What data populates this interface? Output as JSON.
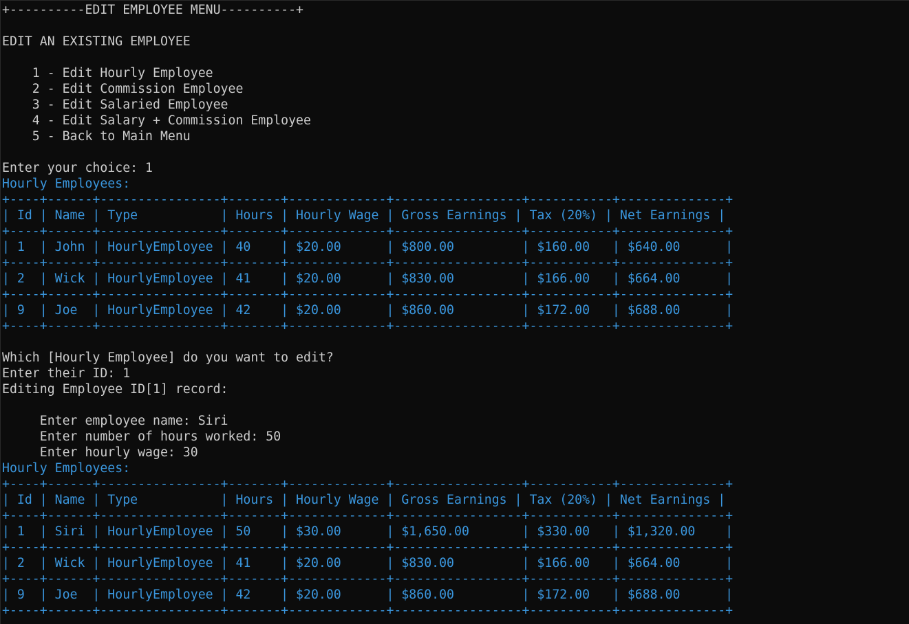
{
  "lines": [
    {
      "text": "+----------EDIT EMPLOYEE MENU----------+",
      "color": "white"
    },
    {
      "text": "",
      "color": "white"
    },
    {
      "text": "EDIT AN EXISTING EMPLOYEE",
      "color": "white"
    },
    {
      "text": "",
      "color": "white"
    },
    {
      "text": "    1 - Edit Hourly Employee",
      "color": "white"
    },
    {
      "text": "    2 - Edit Commission Employee",
      "color": "white"
    },
    {
      "text": "    3 - Edit Salaried Employee",
      "color": "white"
    },
    {
      "text": "    4 - Edit Salary + Commission Employee",
      "color": "white"
    },
    {
      "text": "    5 - Back to Main Menu",
      "color": "white"
    },
    {
      "text": "",
      "color": "white"
    },
    {
      "text": "Enter your choice: 1",
      "color": "white"
    },
    {
      "text": "Hourly Employees:",
      "color": "blue"
    },
    {
      "text": "+----+------+----------------+-------+-------------+-----------------+-----------+--------------+",
      "color": "blue"
    },
    {
      "text": "| Id | Name | Type           | Hours | Hourly Wage | Gross Earnings | Tax (20%) | Net Earnings |",
      "color": "blue"
    },
    {
      "text": "+----+------+----------------+-------+-------------+-----------------+-----------+--------------+",
      "color": "blue"
    },
    {
      "text": "| 1  | John | HourlyEmployee | 40    | $20.00      | $800.00         | $160.00   | $640.00      |",
      "color": "blue"
    },
    {
      "text": "+----+------+----------------+-------+-------------+-----------------+-----------+--------------+",
      "color": "blue"
    },
    {
      "text": "| 2  | Wick | HourlyEmployee | 41    | $20.00      | $830.00         | $166.00   | $664.00      |",
      "color": "blue"
    },
    {
      "text": "+----+------+----------------+-------+-------------+-----------------+-----------+--------------+",
      "color": "blue"
    },
    {
      "text": "| 9  | Joe  | HourlyEmployee | 42    | $20.00      | $860.00         | $172.00   | $688.00      |",
      "color": "blue"
    },
    {
      "text": "+----+------+----------------+-------+-------------+-----------------+-----------+--------------+",
      "color": "blue"
    },
    {
      "text": "",
      "color": "white"
    },
    {
      "text": "Which [Hourly Employee] do you want to edit?",
      "color": "white"
    },
    {
      "text": "Enter their ID: 1",
      "color": "white"
    },
    {
      "text": "Editing Employee ID[1] record:",
      "color": "white"
    },
    {
      "text": "",
      "color": "white"
    },
    {
      "text": "     Enter employee name: Siri",
      "color": "white"
    },
    {
      "text": "     Enter number of hours worked: 50",
      "color": "white"
    },
    {
      "text": "     Enter hourly wage: 30",
      "color": "white"
    },
    {
      "text": "Hourly Employees:",
      "color": "blue"
    },
    {
      "text": "+----+------+----------------+-------+-------------+-----------------+-----------+--------------+",
      "color": "blue"
    },
    {
      "text": "| Id | Name | Type           | Hours | Hourly Wage | Gross Earnings | Tax (20%) | Net Earnings |",
      "color": "blue"
    },
    {
      "text": "+----+------+----------------+-------+-------------+-----------------+-----------+--------------+",
      "color": "blue"
    },
    {
      "text": "| 1  | Siri | HourlyEmployee | 50    | $30.00      | $1,650.00       | $330.00   | $1,320.00    |",
      "color": "blue"
    },
    {
      "text": "+----+------+----------------+-------+-------------+-----------------+-----------+--------------+",
      "color": "blue"
    },
    {
      "text": "| 2  | Wick | HourlyEmployee | 41    | $20.00      | $830.00         | $166.00   | $664.00      |",
      "color": "blue"
    },
    {
      "text": "+----+------+----------------+-------+-------------+-----------------+-----------+--------------+",
      "color": "blue"
    },
    {
      "text": "| 9  | Joe  | HourlyEmployee | 42    | $20.00      | $860.00         | $172.00   | $688.00      |",
      "color": "blue"
    },
    {
      "text": "+----+------+----------------+-------+-------------+-----------------+-----------+--------------+",
      "color": "blue"
    }
  ],
  "colors": {
    "background": "#0c0c0c",
    "text": "#cccccc",
    "accent": "#3a96dd"
  }
}
